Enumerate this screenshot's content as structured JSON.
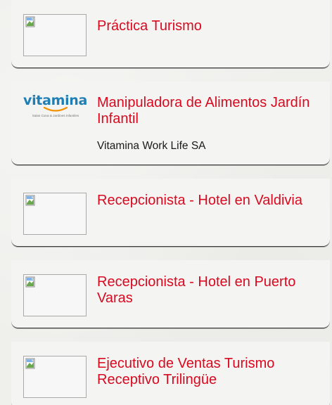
{
  "jobs": [
    {
      "title": "Práctica Turismo",
      "company": ""
    },
    {
      "title": "Manipuladora de Alimentos Jardín Infantil",
      "company": "Vitamina Work Life SA",
      "logo": {
        "word": "vitamina",
        "tagline": "Salas Cuna & Jardines Infantiles",
        "color": "#1f7fb4",
        "accent": "#f39200"
      }
    },
    {
      "title": "Recepcionista - Hotel en Valdivia",
      "company": ""
    },
    {
      "title": "Recepcionista - Hotel en Puerto Varas",
      "company": ""
    },
    {
      "title": "Ejecutivo de Ventas Turismo Receptivo Trilingüe",
      "company": ""
    }
  ],
  "colors": {
    "title": "#d9091f",
    "background": "#efefec"
  }
}
